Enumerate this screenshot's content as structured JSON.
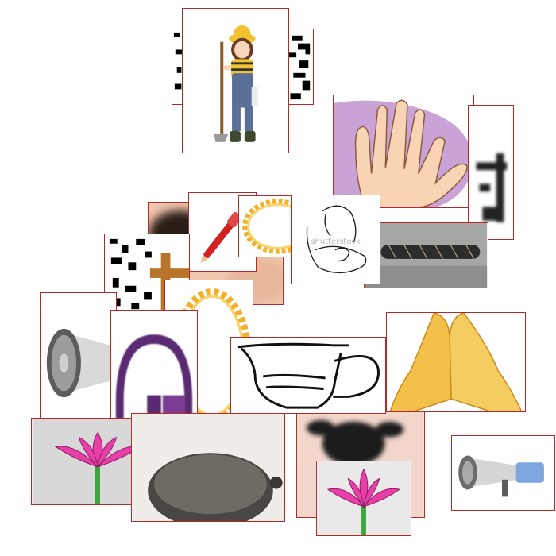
{
  "canvas": {
    "background": "#ffffff",
    "card_border": "#b22a2a"
  },
  "collage_items": [
    {
      "name": "noise-pattern-card",
      "icon": "black-white-noise-pattern"
    },
    {
      "name": "noise-pattern-card-right",
      "icon": "black-white-noise-pattern"
    },
    {
      "name": "farmer-girl-card",
      "icon": "farmer-girl-with-hoe-illustration"
    },
    {
      "name": "hand-card",
      "icon": "open-palm-hand-illustration"
    },
    {
      "name": "blurry-letters-card",
      "icon": "blurred-black-letters"
    },
    {
      "name": "wrapped-stick-card",
      "icon": "wrapped-stick-photo"
    },
    {
      "name": "dark-blur-photo-card",
      "icon": "dark-blurred-photo"
    },
    {
      "name": "red-pen-card",
      "icon": "red-pen-illustration"
    },
    {
      "name": "sun-ring-card",
      "icon": "flaming-sun-ring"
    },
    {
      "name": "mother-baby-card",
      "icon": "mother-and-baby-line-sketch",
      "watermark": "shutterstock"
    },
    {
      "name": "noise-cross-card",
      "icon": "noise-pattern-with-wooden-cross"
    },
    {
      "name": "sun-ring-card-large",
      "icon": "flaming-sun-ring"
    },
    {
      "name": "megaphone-card",
      "icon": "megaphone-icon"
    },
    {
      "name": "logo-arch-card",
      "icon": "purple-arch-logo"
    },
    {
      "name": "lotus-card",
      "icon": "pink-lotus-flower"
    },
    {
      "name": "pot-photo-card",
      "icon": "dark-round-pot-photo"
    },
    {
      "name": "pitcher-card",
      "icon": "gravy-boat-pitcher-line-art"
    },
    {
      "name": "praying-hands-card",
      "icon": "praying-hands-illustration"
    },
    {
      "name": "goat-photo-card",
      "icon": "black-goat-kid-photo"
    },
    {
      "name": "lotus-card-small",
      "icon": "pink-lotus-flower"
    },
    {
      "name": "megaphone-card-blue",
      "icon": "blue-megaphone-icon"
    }
  ]
}
